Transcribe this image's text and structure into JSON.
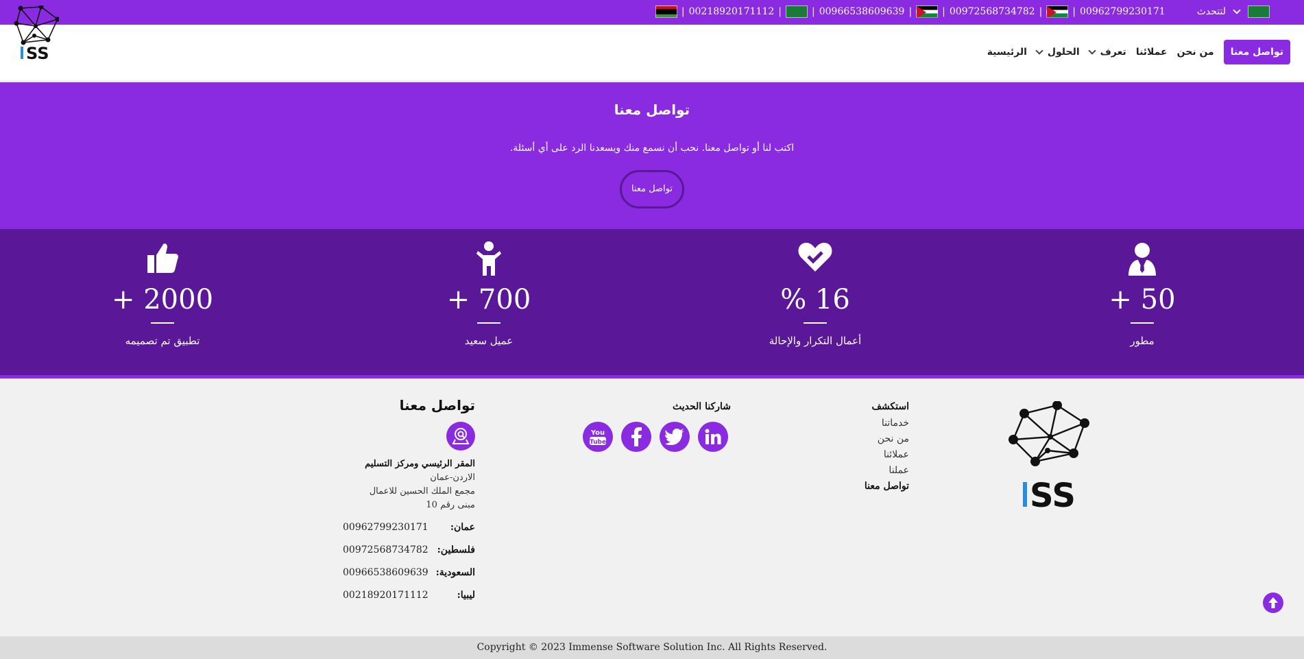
{
  "colors": {
    "brand": "#8a2be2",
    "stats_bg": "#5a1898",
    "footer_bg": "#f1f1f1"
  },
  "topbar": {
    "language_label": "لتتحدث",
    "phones": [
      {
        "flag": "jo",
        "number": "00962799230171"
      },
      {
        "flag": "ps",
        "number": "00972568734782"
      },
      {
        "flag": "sa",
        "number": "00966538609639"
      },
      {
        "flag": "ly",
        "number": "00218920171112"
      }
    ]
  },
  "nav": {
    "contact_cta": "تواصل معنا",
    "about": "من نحن",
    "clients": "عملائنا",
    "know": "تعرف",
    "solutions": "الحلول",
    "home": "الرئيسية"
  },
  "contact_band": {
    "title": "تواصل معنا",
    "text": "اكتب لنا أو تواصل معنا. نحب أن نسمع منك ويسعدنا الرد على أي أسئلة.",
    "button": "تواصل معنا"
  },
  "stats": [
    {
      "icon": "user-tie-icon",
      "value": "+ 50",
      "label": "مطور"
    },
    {
      "icon": "heart-check-icon",
      "value": "% 16",
      "label": "أعمال التكرار والإحالة"
    },
    {
      "icon": "child-icon",
      "value": "+ 700",
      "label": "عميل سعيد"
    },
    {
      "icon": "thumbs-up-icon",
      "value": "+ 2000",
      "label": "تطبيق تم تصميمه"
    }
  ],
  "footer": {
    "explore": {
      "title": "استكشف",
      "links": [
        "خدماتنا",
        "من نحن",
        "عملائنا",
        "عملنا",
        "تواصل معنا"
      ]
    },
    "share": {
      "title": "شاركنا الحديث",
      "socials": [
        "linkedin-icon",
        "twitter-icon",
        "facebook-icon",
        "youtube-icon"
      ]
    },
    "contact": {
      "title": "تواصل معنا",
      "address_title": "المقر الرئيسي ومركز التسليم",
      "address_lines": [
        "الاردن-عمان",
        "مجمع الملك الحسين للاعمال",
        "مبنى رقم 10"
      ],
      "phones": [
        {
          "country": "عمان:",
          "number": "00962799230171"
        },
        {
          "country": "فلسطين:",
          "number": "00972568734782"
        },
        {
          "country": "السعودية:",
          "number": "00966538609639"
        },
        {
          "country": "ليبيا:",
          "number": "00218920171112"
        }
      ]
    }
  },
  "copyright": "Copyright © 2023 Immense Software Solution Inc. All Rights Reserved."
}
